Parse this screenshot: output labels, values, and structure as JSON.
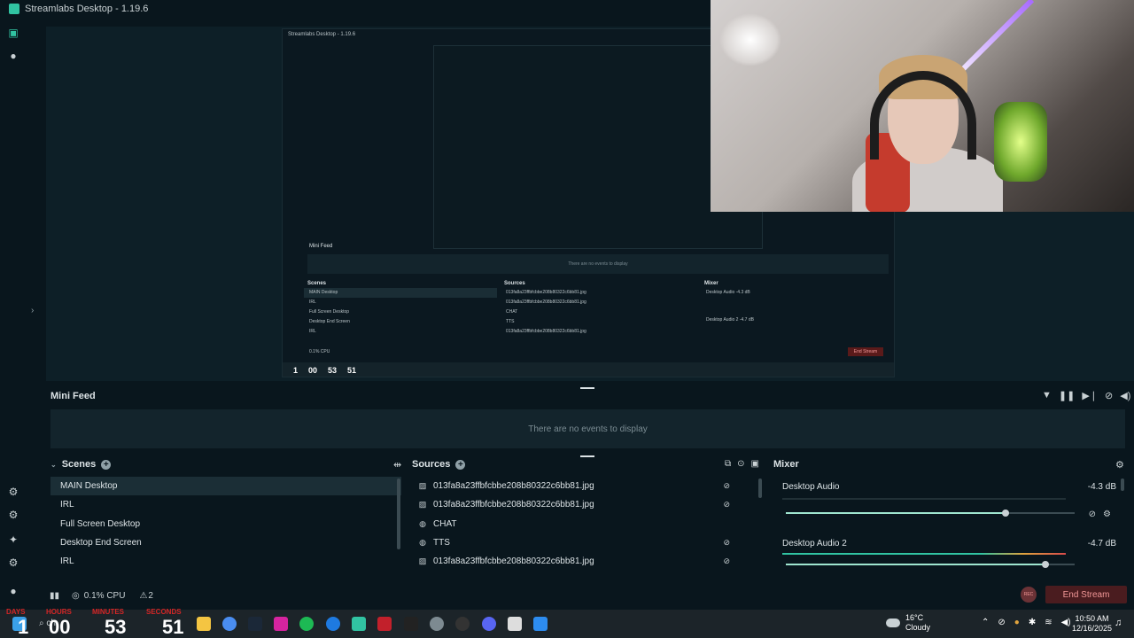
{
  "window": {
    "title": "Streamlabs Desktop - 1.19.6"
  },
  "preview": {
    "title": "Streamlabs Desktop - 1.19.6",
    "mini_feed_title": "Mini Feed",
    "mini_feed_empty": "There are no events to display",
    "scenes_header": "Scenes",
    "sources_header": "Sources",
    "mixer_header": "Mixer",
    "scenes": [
      "MAIN Desktop",
      "IRL",
      "Full Screen Desktop",
      "Desktop End Screen",
      "IRL"
    ],
    "sources": [
      "013fa8a23ffbfcbbe208b80322c6bb81.jpg",
      "013fa8a23ffbfcbbe208b80322c6bb81.jpg",
      "CHAT",
      "TTS",
      "013fa8a23ffbfcbbe208b80322c6bb81.jpg"
    ],
    "mixer": [
      {
        "name": "Desktop Audio",
        "db": "-4.3 dB"
      },
      {
        "name": "Desktop Audio 2",
        "db": "-4.7 dB"
      }
    ],
    "cpu": "0.1% CPU",
    "end_stream": "End Stream",
    "countdown": [
      "1",
      "00",
      "53",
      "51"
    ]
  },
  "mini_feed": {
    "title": "Mini Feed",
    "empty_text": "There are no events to display"
  },
  "scenes": {
    "title": "Scenes",
    "items": [
      "MAIN Desktop",
      "IRL",
      "Full Screen Desktop",
      "Desktop End Screen",
      "IRL"
    ]
  },
  "sources": {
    "title": "Sources",
    "items": [
      {
        "name": "013fa8a23ffbfcbbe208b80322c6bb81.jpg",
        "icon": "image-icon"
      },
      {
        "name": "013fa8a23ffbfcbbe208b80322c6bb81.jpg",
        "icon": "image-icon"
      },
      {
        "name": "CHAT",
        "icon": "globe-icon"
      },
      {
        "name": "TTS",
        "icon": "globe-icon"
      },
      {
        "name": "013fa8a23ffbfcbbe208b80322c6bb81.jpg",
        "icon": "image-icon"
      }
    ]
  },
  "mixer": {
    "title": "Mixer",
    "channels": [
      {
        "name": "Desktop Audio",
        "db": "-4.3 dB",
        "level": 0.76
      },
      {
        "name": "Desktop Audio 2",
        "db": "-4.7 dB",
        "level": 0.9
      }
    ]
  },
  "status": {
    "cpu": "0.1% CPU",
    "notifications": "2",
    "rec": "REC",
    "end_stream": "End Stream"
  },
  "countdown": {
    "labels": [
      "DAYS",
      "HOURS",
      "MINUTES",
      "SECONDS"
    ],
    "values": [
      "1",
      "00",
      "53",
      "51"
    ]
  },
  "taskbar": {
    "search_text": "ch",
    "weather_temp": "16°C",
    "weather_desc": "Cloudy",
    "time": "10:50 AM",
    "date": "12/16/2025"
  },
  "colors": {
    "accent": "#31c3a2",
    "background": "#09161d",
    "panel": "#13242c",
    "end_stream": "#4a1c1f",
    "countdown_label": "#d32626"
  }
}
